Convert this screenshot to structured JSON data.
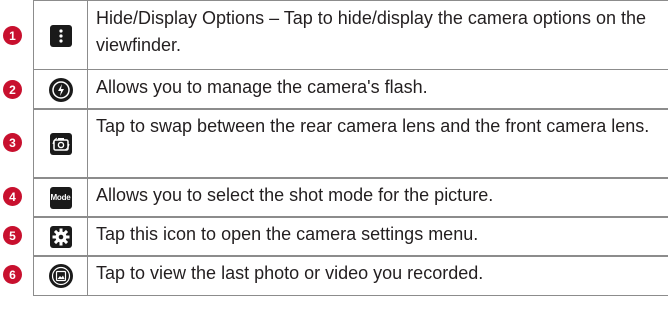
{
  "rows": [
    {
      "number": "1",
      "icon": "more-vertical-icon",
      "text": "Hide/Display Options – Tap to hide/display the camera options on the viewfinder."
    },
    {
      "number": "2",
      "icon": "flash-icon",
      "text": "Allows you to manage the camera's flash."
    },
    {
      "number": "3",
      "icon": "swap-camera-icon",
      "text": "Tap to swap between the rear camera lens and the front camera lens."
    },
    {
      "number": "4",
      "icon": "mode-icon",
      "icon_label": "Mode",
      "text": "Allows you to select the shot mode for the picture."
    },
    {
      "number": "5",
      "icon": "gear-icon",
      "text": "Tap this icon to open the camera settings menu."
    },
    {
      "number": "6",
      "icon": "gallery-icon",
      "text": "Tap to view the last photo or video you recorded."
    }
  ],
  "colors": {
    "number_badge": "#c8102e",
    "icon_bg": "#1a1a1a",
    "rule": "#8c8c8c",
    "text": "#231f20"
  }
}
